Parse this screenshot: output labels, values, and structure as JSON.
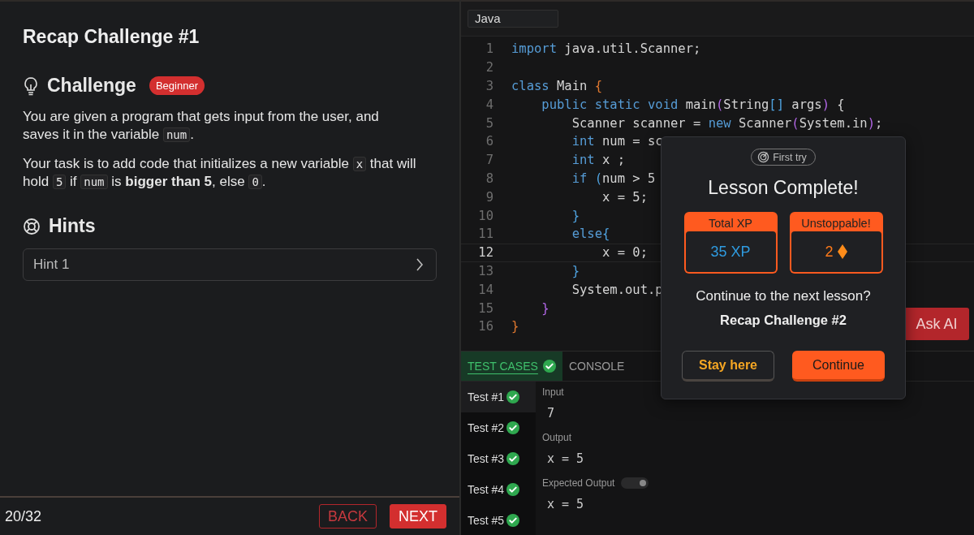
{
  "lesson": {
    "title": "Recap Challenge #1",
    "challenge": {
      "heading": "Challenge",
      "level_badge": "Beginner",
      "paragraphs": [
        [
          {
            "kind": "text",
            "text": "You are given a program that gets input from the user, and saves it in the variable "
          },
          {
            "kind": "code",
            "text": "num"
          },
          {
            "kind": "text",
            "text": "."
          }
        ],
        [
          {
            "kind": "text",
            "text": "Your task is to add code that initializes a new variable "
          },
          {
            "kind": "code",
            "text": "x"
          },
          {
            "kind": "text",
            "text": " that will hold "
          },
          {
            "kind": "code",
            "text": "5"
          },
          {
            "kind": "text",
            "text": " if "
          },
          {
            "kind": "code",
            "text": "num"
          },
          {
            "kind": "text",
            "text": " is "
          },
          {
            "kind": "bold",
            "text": "bigger than 5"
          },
          {
            "kind": "text",
            "text": ", else "
          },
          {
            "kind": "code",
            "text": "0"
          },
          {
            "kind": "text",
            "text": "."
          }
        ]
      ]
    },
    "hints": {
      "heading": "Hints",
      "items": [
        {
          "label": "Hint 1",
          "expanded": false
        }
      ]
    },
    "footer": {
      "progress": "20/32",
      "back": "BACK",
      "next": "NEXT"
    }
  },
  "editor": {
    "language": "Java",
    "lines": [
      {
        "number": "1",
        "current": false,
        "tokens": [
          {
            "kind": "kw",
            "text": "import"
          },
          {
            "kind": "plain",
            "text": " java.util.Scanner;"
          }
        ]
      },
      {
        "number": "2",
        "current": false
      },
      {
        "number": "3",
        "current": false,
        "tokens": [
          {
            "kind": "kw",
            "text": "class"
          },
          {
            "kind": "plain",
            "text": " Main "
          },
          {
            "kind": "brace1",
            "text": "{"
          }
        ]
      },
      {
        "number": "4",
        "current": false,
        "tokens": [
          {
            "kind": "kw",
            "text": "    public static void"
          },
          {
            "kind": "plain",
            "text": " main"
          },
          {
            "kind": "brace2",
            "text": "("
          },
          {
            "kind": "plain",
            "text": "String"
          },
          {
            "kind": "brace3",
            "text": "[]"
          },
          {
            "kind": "plain",
            "text": " args"
          },
          {
            "kind": "brace2",
            "text": ")"
          },
          {
            "kind": "plain",
            "text": " {"
          }
        ]
      },
      {
        "number": "5",
        "current": false,
        "tokens": [
          {
            "kind": "plain",
            "text": "        Scanner scanner = "
          },
          {
            "kind": "kw",
            "text": "new"
          },
          {
            "kind": "plain",
            "text": " Scanner"
          },
          {
            "kind": "brace2",
            "text": "("
          },
          {
            "kind": "plain",
            "text": "System.in"
          },
          {
            "kind": "brace2",
            "text": ")"
          },
          {
            "kind": "plain",
            "text": ";"
          }
        ]
      },
      {
        "number": "6",
        "current": false,
        "tokens": [
          {
            "kind": "kw",
            "text": "        int"
          },
          {
            "kind": "plain",
            "text": " num = sc"
          }
        ]
      },
      {
        "number": "7",
        "current": false,
        "tokens": [
          {
            "kind": "kw",
            "text": "        int"
          },
          {
            "kind": "plain",
            "text": " x ;"
          }
        ]
      },
      {
        "number": "8",
        "current": false,
        "tokens": [
          {
            "kind": "kw",
            "text": "        if "
          },
          {
            "kind": "brace3",
            "text": "("
          },
          {
            "kind": "plain",
            "text": "num > 5"
          }
        ]
      },
      {
        "number": "9",
        "current": false,
        "tokens": [
          {
            "kind": "plain",
            "text": "            x = 5;"
          }
        ]
      },
      {
        "number": "10",
        "current": false,
        "tokens": [
          {
            "kind": "brace3",
            "text": "        }"
          }
        ]
      },
      {
        "number": "11",
        "current": false,
        "tokens": [
          {
            "kind": "kw",
            "text": "        else"
          },
          {
            "kind": "brace3",
            "text": "{"
          }
        ]
      },
      {
        "number": "12",
        "current": true,
        "tokens": [
          {
            "kind": "plain",
            "text": "            x = 0;"
          }
        ]
      },
      {
        "number": "13",
        "current": false,
        "tokens": [
          {
            "kind": "brace3",
            "text": "        }"
          }
        ]
      },
      {
        "number": "14",
        "current": false,
        "tokens": [
          {
            "kind": "plain",
            "text": "        System.out.p"
          }
        ]
      },
      {
        "number": "15",
        "current": false,
        "tokens": [
          {
            "kind": "brace2",
            "text": "    }"
          }
        ]
      },
      {
        "number": "16",
        "current": false,
        "tokens": [
          {
            "kind": "brace1",
            "text": "}"
          }
        ]
      }
    ],
    "ask_ai": "Ask AI"
  },
  "tests": {
    "tabs": [
      {
        "label": "TEST CASES",
        "selected": true,
        "passed": true
      },
      {
        "label": "CONSOLE",
        "selected": false,
        "passed": false
      }
    ],
    "cases": [
      {
        "label": "Test #1",
        "selected": true,
        "passed": true
      },
      {
        "label": "Test #2",
        "selected": false,
        "passed": true
      },
      {
        "label": "Test #3",
        "selected": false,
        "passed": true
      },
      {
        "label": "Test #4",
        "selected": false,
        "passed": true
      },
      {
        "label": "Test #5",
        "selected": false,
        "passed": true
      }
    ],
    "input_label": "Input",
    "input": "7",
    "output_label": "Output",
    "output": "x = 5",
    "expected_label": "Expected Output",
    "expected_toggle": {
      "on": true
    },
    "expected": "x = 5"
  },
  "modal": {
    "badge": "First try",
    "title": "Lesson Complete!",
    "stats": [
      {
        "label": "Total XP",
        "value": "35",
        "unit": "XP",
        "kind": "xp"
      },
      {
        "label": "Unstoppable!",
        "value": "2",
        "kind": "streak"
      }
    ],
    "question": "Continue to the next lesson?",
    "next_lesson": "Recap Challenge #2",
    "stay": "Stay here",
    "continue": "Continue"
  }
}
